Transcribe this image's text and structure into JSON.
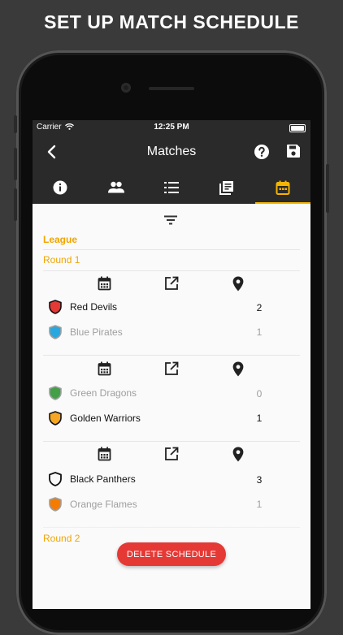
{
  "headline": "SET UP MATCH SCHEDULE",
  "status_bar": {
    "carrier": "Carrier",
    "time": "12:25 PM"
  },
  "app_bar": {
    "title": "Matches"
  },
  "tabs": [
    {
      "icon": "info-icon",
      "active": false
    },
    {
      "icon": "people-icon",
      "active": false
    },
    {
      "icon": "list-icon",
      "active": false
    },
    {
      "icon": "library-icon",
      "active": false
    },
    {
      "icon": "calendar-icon",
      "active": true
    }
  ],
  "schedule": {
    "section_title": "League",
    "rounds": [
      {
        "label": "Round 1",
        "matches": [
          {
            "home": {
              "name": "Red Devils",
              "color": "#e53935",
              "score": "2",
              "muted": false
            },
            "away": {
              "name": "Blue Pirates",
              "color": "#29a8e0",
              "score": "1",
              "muted": true
            }
          },
          {
            "home": {
              "name": "Green Dragons",
              "color": "#43a047",
              "score": "0",
              "muted": true
            },
            "away": {
              "name": "Golden Warriors",
              "color": "#f5a623",
              "score": "1",
              "muted": false
            }
          },
          {
            "home": {
              "name": "Black Panthers",
              "color": "#212121",
              "score": "3",
              "muted": false
            },
            "away": {
              "name": "Orange Flames",
              "color": "#f57c00",
              "score": "1",
              "muted": true
            }
          }
        ]
      },
      {
        "label": "Round 2"
      }
    ]
  },
  "delete_button_label": "DELETE SCHEDULE",
  "colors": {
    "accent": "#f5b400",
    "danger": "#e53935",
    "toolbar": "#2a2a2a"
  }
}
